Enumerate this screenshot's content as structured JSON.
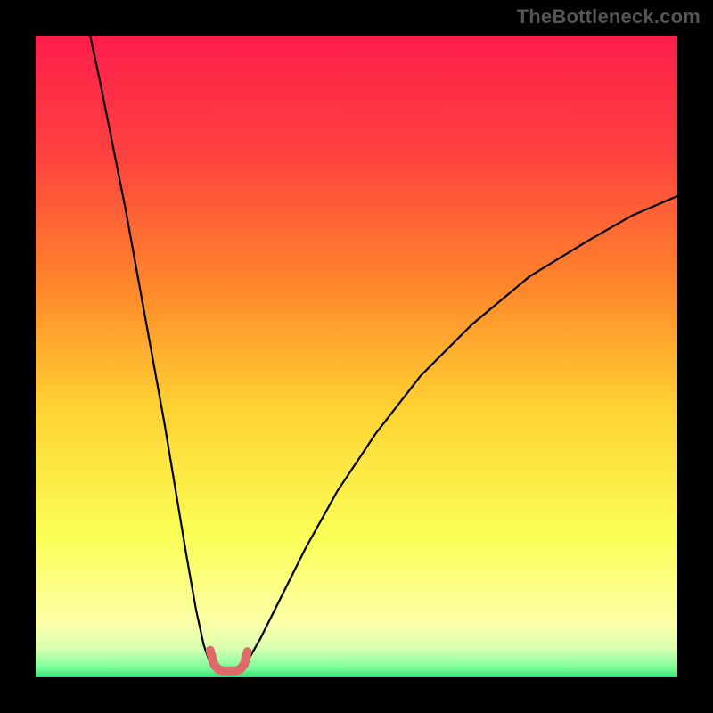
{
  "watermark": "TheBottleneck.com",
  "chart_data": {
    "type": "line",
    "title": "",
    "xlabel": "",
    "ylabel": "",
    "xlim": [
      0,
      100
    ],
    "ylim": [
      0,
      100
    ],
    "background_gradient": {
      "stops": [
        {
          "offset": 0.0,
          "color": "#ff1e4b"
        },
        {
          "offset": 0.18,
          "color": "#ff4040"
        },
        {
          "offset": 0.4,
          "color": "#ff8a2a"
        },
        {
          "offset": 0.58,
          "color": "#ffd233"
        },
        {
          "offset": 0.78,
          "color": "#faff55"
        },
        {
          "offset": 0.915,
          "color": "#fdffa8"
        },
        {
          "offset": 0.955,
          "color": "#d9ffb0"
        },
        {
          "offset": 0.985,
          "color": "#7cff9c"
        },
        {
          "offset": 1.0,
          "color": "#33e07a"
        }
      ]
    },
    "series": [
      {
        "name": "curve-left",
        "stroke": "#000000",
        "stroke_width": 2.2,
        "x": [
          8.5,
          10,
          12,
          14,
          16,
          18,
          20,
          22,
          23.5,
          25,
          26.2,
          27.2,
          28
        ],
        "y": [
          100,
          93,
          83,
          73,
          62,
          51,
          40,
          28,
          19,
          10.5,
          5,
          2.2,
          1.2
        ]
      },
      {
        "name": "curve-right",
        "stroke": "#000000",
        "stroke_width": 2.2,
        "x": [
          32,
          33,
          35,
          38,
          42,
          47,
          53,
          60,
          68,
          77,
          86,
          93,
          100
        ],
        "y": [
          1.2,
          2.5,
          6,
          12,
          20,
          29,
          38,
          47,
          55,
          62.5,
          68,
          72,
          75
        ]
      },
      {
        "name": "highlight-bucket",
        "stroke": "#e06a6a",
        "stroke_width": 10,
        "linecap": "round",
        "linejoin": "round",
        "x": [
          27.2,
          27.8,
          28.5,
          29.3,
          30.2,
          31.0,
          31.8,
          32.5,
          33.0
        ],
        "y": [
          4.2,
          2.0,
          1.2,
          1.0,
          1.0,
          1.0,
          1.2,
          2.0,
          4.0
        ]
      }
    ]
  }
}
